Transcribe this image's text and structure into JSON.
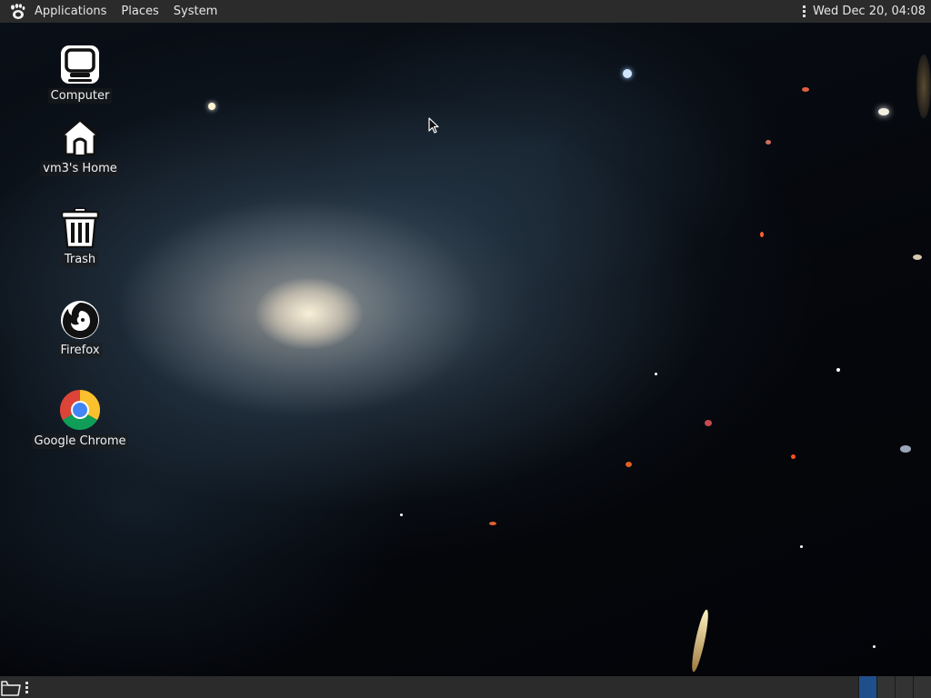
{
  "top_panel": {
    "menus": [
      "Applications",
      "Places",
      "System"
    ],
    "clock": "Wed Dec 20, 04:08"
  },
  "desktop": {
    "icons": [
      {
        "label": "Computer",
        "icon": "computer-icon"
      },
      {
        "label": "vm3's Home",
        "icon": "home-folder-icon"
      },
      {
        "label": "Trash",
        "icon": "trash-icon"
      },
      {
        "label": "Firefox",
        "icon": "firefox-icon"
      },
      {
        "label": "Google Chrome",
        "icon": "chrome-icon"
      }
    ]
  },
  "bottom_panel": {
    "workspaces": 4,
    "active_workspace": 1
  },
  "colors": {
    "panel_bg": "#2b2b2b",
    "active_workspace": "#1f4f8a"
  }
}
